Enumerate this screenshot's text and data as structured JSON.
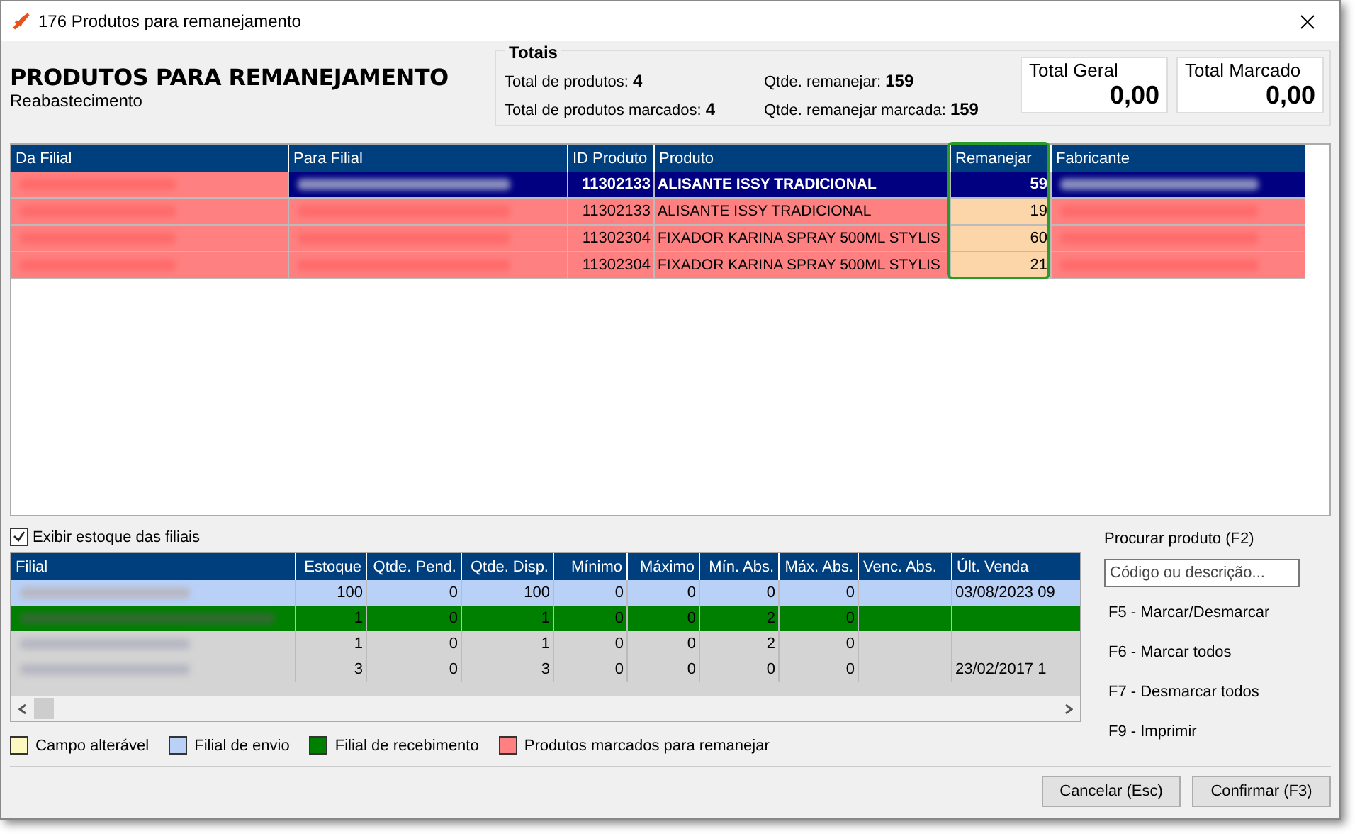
{
  "window": {
    "title": "176 Produtos para remanejamento"
  },
  "header": {
    "title": "PRODUTOS PARA REMANEJAMENTO",
    "subtitle": "Reabastecimento"
  },
  "totals": {
    "title": "Totais",
    "items": [
      {
        "label": "Total de produtos:",
        "value": "4"
      },
      {
        "label": "Total de produtos marcados:",
        "value": "4"
      },
      {
        "label": "Qtde. remanejar:",
        "value": "159"
      },
      {
        "label": "Qtde. remanejar marcada:",
        "value": "159"
      }
    ],
    "cards": [
      {
        "label": "Total Geral",
        "value": "0,00"
      },
      {
        "label": "Total Marcado",
        "value": "0,00"
      }
    ]
  },
  "products": {
    "columns": [
      "Da Filial",
      "Para Filial",
      "ID Produto",
      "Produto",
      "Remanejar",
      "Fabricante"
    ],
    "rows": [
      {
        "selected": true,
        "marked": true,
        "id": "11302133",
        "product": "ALISANTE ISSY TRADICIONAL",
        "qty": "59"
      },
      {
        "selected": false,
        "marked": true,
        "id": "11302133",
        "product": "ALISANTE ISSY TRADICIONAL",
        "qty": "19"
      },
      {
        "selected": false,
        "marked": true,
        "id": "11302304",
        "product": "FIXADOR KARINA  SPRAY 500ML STYLIS",
        "qty": "60"
      },
      {
        "selected": false,
        "marked": true,
        "id": "11302304",
        "product": "FIXADOR KARINA  SPRAY 500ML STYLIS",
        "qty": "21"
      }
    ]
  },
  "stock": {
    "checkbox": {
      "label": "Exibir estoque das filiais",
      "checked": true
    },
    "columns": [
      "Filial",
      "Estoque",
      "Qtde. Pend.",
      "Qtde. Disp.",
      "Mínimo",
      "Máximo",
      "Mín. Abs.",
      "Máx. Abs.",
      "Venc. Abs.",
      "Últ. Venda"
    ],
    "rows": [
      {
        "kind": "sending",
        "cells": [
          "",
          "100",
          "0",
          "100",
          "0",
          "0",
          "0",
          "0",
          "",
          "03/08/2023 09"
        ]
      },
      {
        "kind": "receiving",
        "cells": [
          "",
          "1",
          "0",
          "1",
          "0",
          "0",
          "2",
          "0",
          "",
          ""
        ]
      },
      {
        "kind": "other",
        "cells": [
          "",
          "1",
          "0",
          "1",
          "0",
          "0",
          "2",
          "0",
          "",
          ""
        ]
      },
      {
        "kind": "other",
        "cells": [
          "",
          "3",
          "0",
          "3",
          "0",
          "0",
          "0",
          "0",
          "",
          "23/02/2017 1"
        ]
      }
    ]
  },
  "legend": [
    {
      "label": "Campo alterável",
      "color": "#fdf8c0"
    },
    {
      "label": "Filial de envio",
      "color": "#b9d1f7"
    },
    {
      "label": "Filial de recebimento",
      "color": "#008000"
    },
    {
      "label": "Produtos marcados para remanejar",
      "color": "#ff8080"
    }
  ],
  "search": {
    "label": "Procurar produto (F2)",
    "placeholder": "Código ou descrição..."
  },
  "shortcuts": [
    "F5 - Marcar/Desmarcar",
    "F6 - Marcar todos",
    "F7 - Desmarcar todos",
    "F9 - Imprimir"
  ],
  "buttons": [
    "Cancelar (Esc)",
    "Confirmar (F3)"
  ]
}
